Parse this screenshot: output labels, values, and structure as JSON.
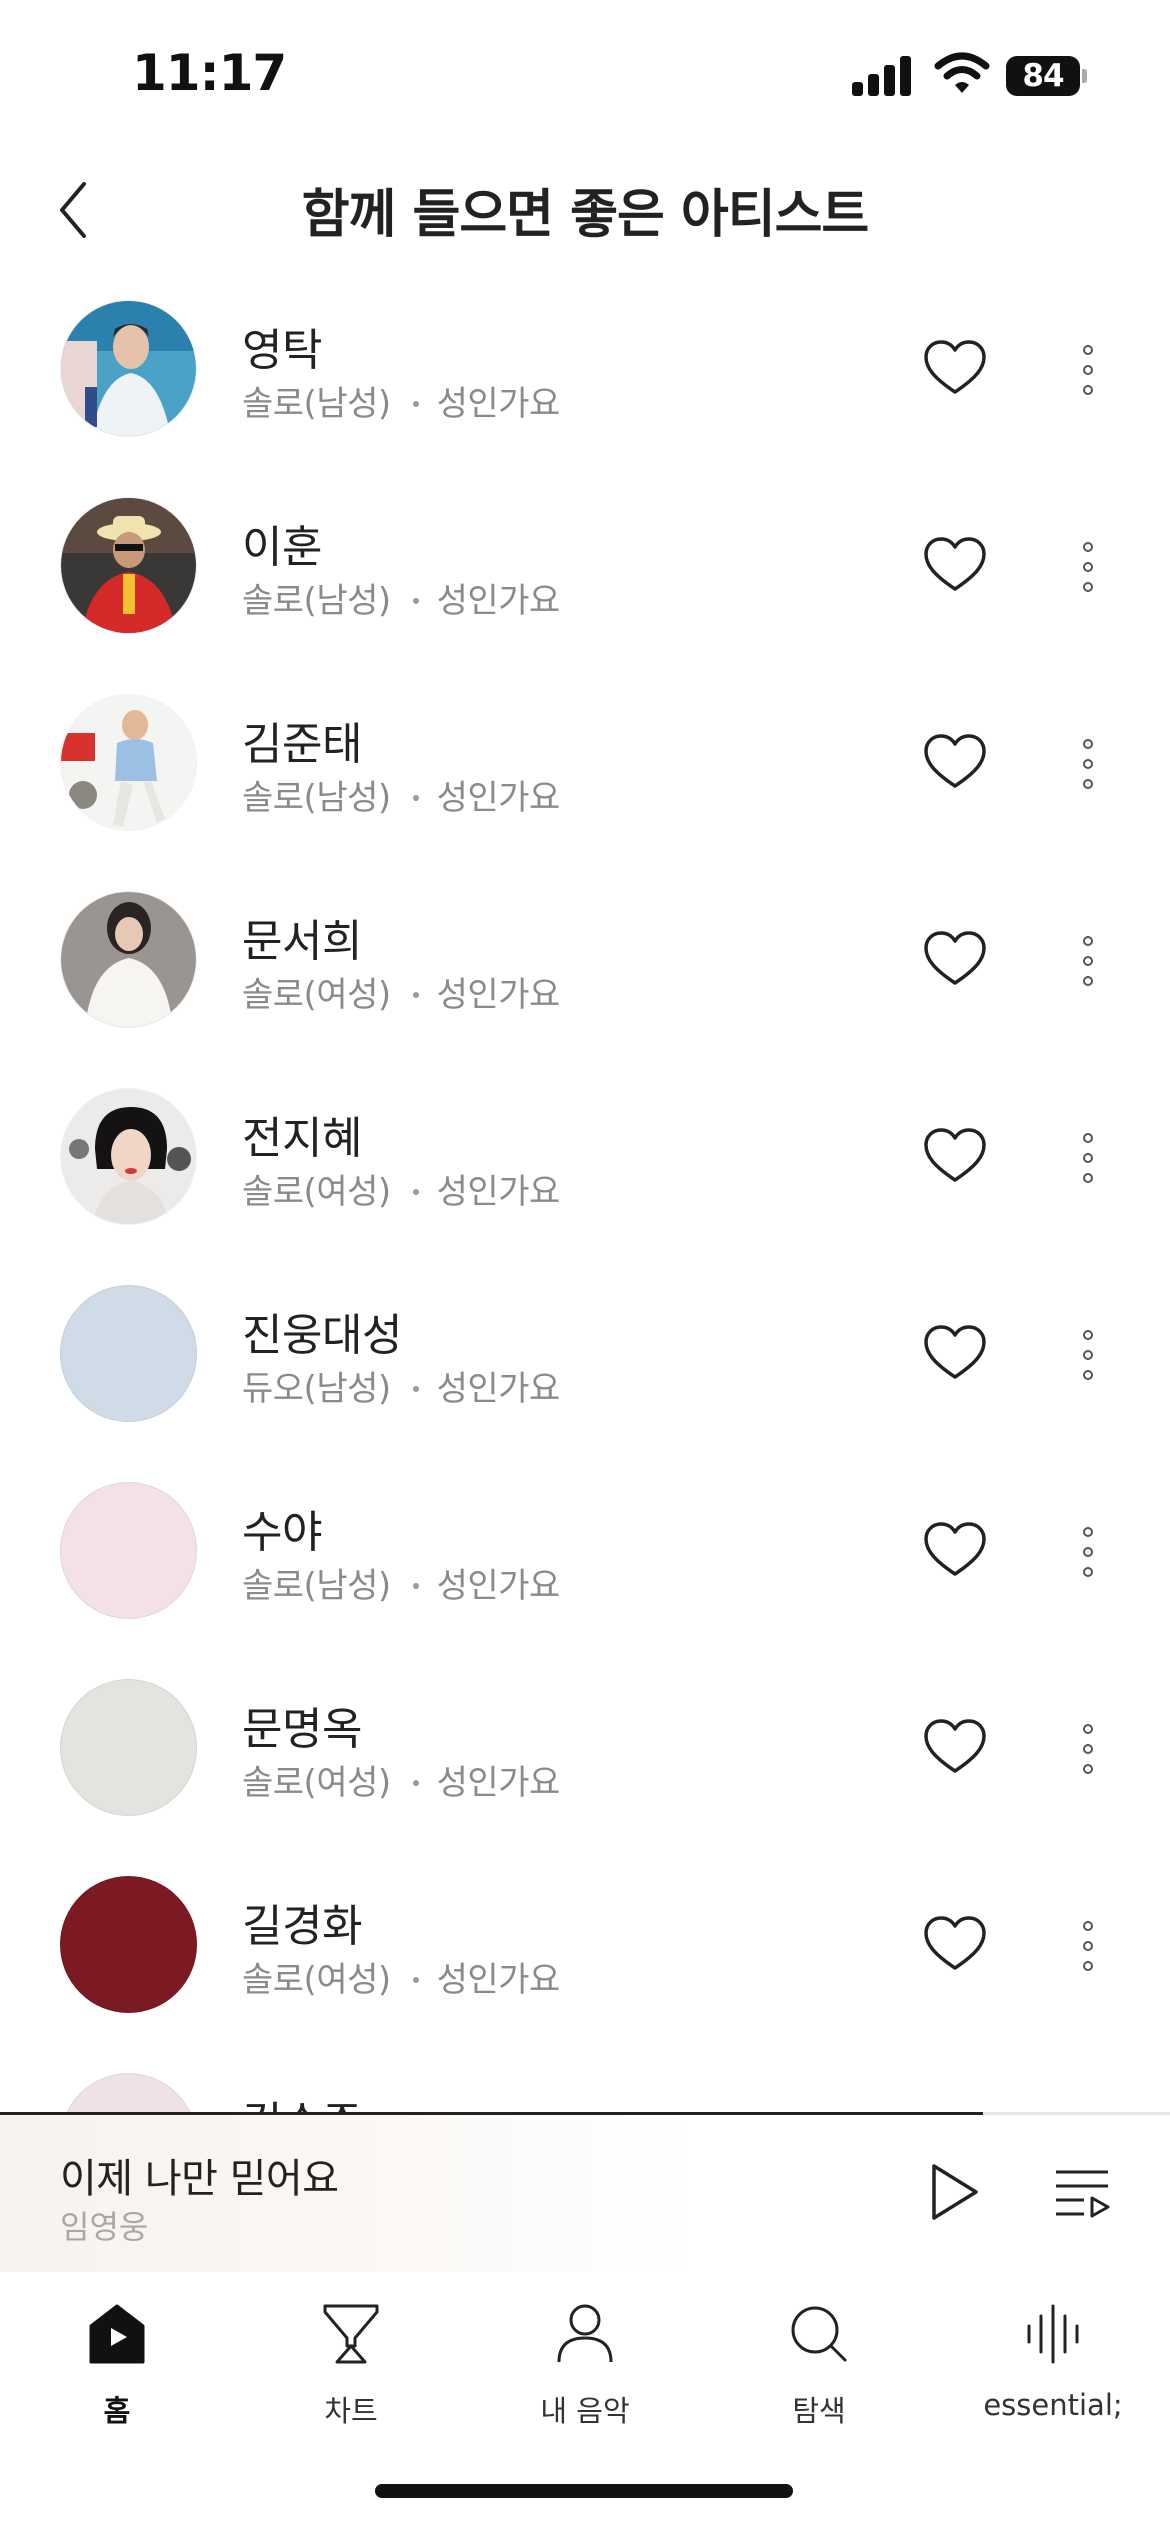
{
  "status_bar": {
    "time": "11:17",
    "battery": "84"
  },
  "header": {
    "title": "함께 들으면 좋은 아티스트",
    "back_icon": "chevron-left-icon"
  },
  "artists": [
    {
      "name": "영탁",
      "type": "솔로(남성)",
      "genre": "성인가요",
      "avatar": "photo"
    },
    {
      "name": "이훈",
      "type": "솔로(남성)",
      "genre": "성인가요",
      "avatar": "photo"
    },
    {
      "name": "김준태",
      "type": "솔로(남성)",
      "genre": "성인가요",
      "avatar": "photo"
    },
    {
      "name": "문서희",
      "type": "솔로(여성)",
      "genre": "성인가요",
      "avatar": "photo"
    },
    {
      "name": "전지혜",
      "type": "솔로(여성)",
      "genre": "성인가요",
      "avatar": "photo"
    },
    {
      "name": "진웅대성",
      "type": "듀오(남성)",
      "genre": "성인가요",
      "avatar_color": "#cfdbe6"
    },
    {
      "name": "수야",
      "type": "솔로(남성)",
      "genre": "성인가요",
      "avatar_color": "#f3e1e5"
    },
    {
      "name": "문명옥",
      "type": "솔로(여성)",
      "genre": "성인가요",
      "avatar_color": "#e5e3df"
    },
    {
      "name": "길경화",
      "type": "솔로(여성)",
      "genre": "성인가요",
      "avatar_color": "#7b1a22"
    },
    {
      "name": "김수주",
      "type": "",
      "genre": "",
      "avatar_color": "#efe2e4"
    }
  ],
  "row_icons": {
    "like": "heart-outline-icon",
    "more": "more-vertical-icon"
  },
  "mini_player": {
    "title": "이제 나만 믿어요",
    "artist": "임영웅",
    "progress": 0.84,
    "play_icon": "play-icon",
    "queue_icon": "playlist-icon"
  },
  "tabs": [
    {
      "label": "홈",
      "icon": "home-icon",
      "active": true
    },
    {
      "label": "차트",
      "icon": "trophy-icon",
      "active": false
    },
    {
      "label": "내 음악",
      "icon": "person-icon",
      "active": false
    },
    {
      "label": "탐색",
      "icon": "search-icon",
      "active": false
    },
    {
      "label": "essential;",
      "icon": "soundwave-icon",
      "active": false
    }
  ]
}
